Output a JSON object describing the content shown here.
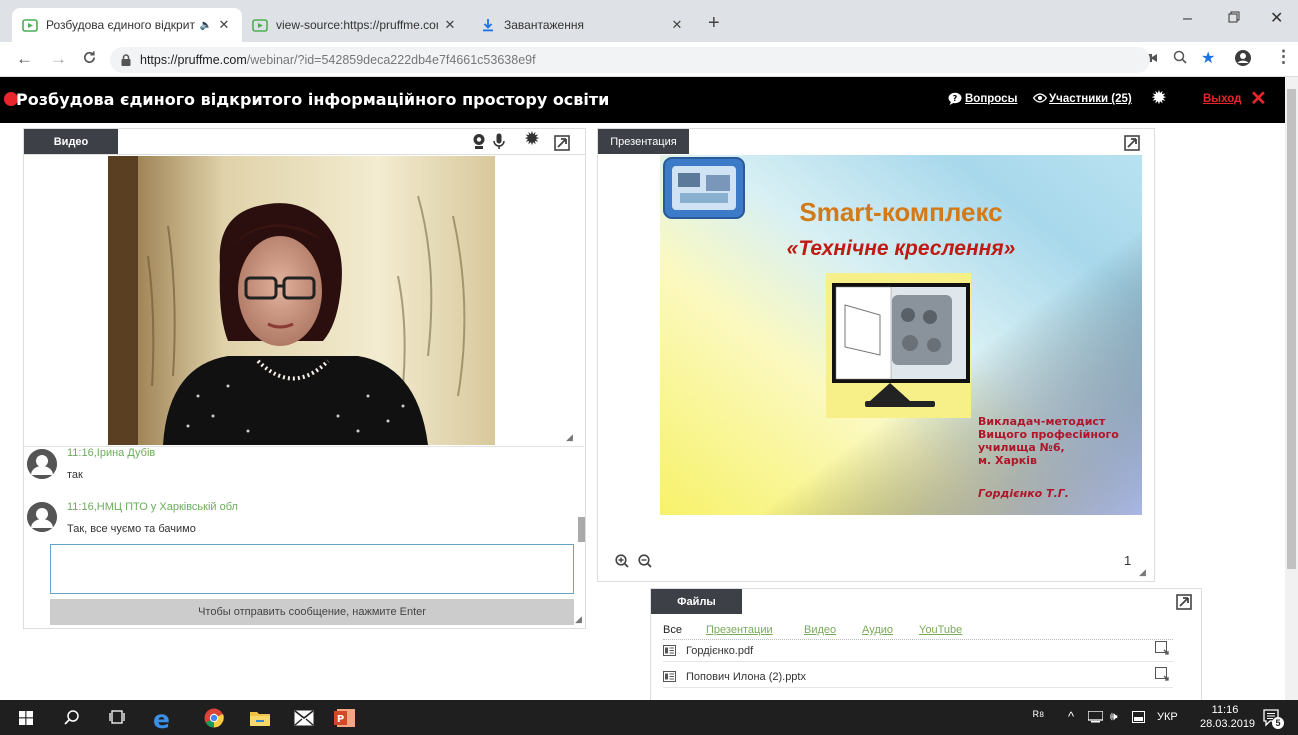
{
  "browser": {
    "tabs": [
      {
        "title": "Розбудова єдиного відкрит",
        "audio": "🔈"
      },
      {
        "title": "view-source:https://pruffme.com"
      },
      {
        "title": "Завантаження"
      }
    ],
    "url_host": "https://pruffme.com",
    "url_path": "/webinar/?id=542859deca222db4e7f4661c53638e9f"
  },
  "webinar": {
    "title": "Розбудова єдиного відкритого інформаційного простору освіти",
    "questions_label": "Вопросы",
    "participants_label": "Участники (25)",
    "exit_label": "Выход"
  },
  "video_panel": {
    "tab_label": "Видео"
  },
  "chat": {
    "messages": [
      {
        "time_name": "11:16,Ірина Дубів",
        "text": "так"
      },
      {
        "time_name": "11:16,НМЦ ПТО у Харківській обл",
        "text": "Так, все чуємо та бачимо"
      }
    ],
    "input_value": "",
    "send_hint": "Чтобы отправить сообщение, нажмите Enter"
  },
  "presentation": {
    "tab_label": "Презентация",
    "slide": {
      "title": "Smart-комплекс",
      "subtitle": "«Технічне креслення»",
      "author_line1": "Викладач-методист",
      "author_line2": "Вищого професійного",
      "author_line3": "училища №6,",
      "author_line4": "м. Харків",
      "author_name": "Гордієнко Т.Г."
    },
    "page_number": "1"
  },
  "files": {
    "tab_label": "Файлы",
    "filters": [
      "Все",
      "Презентации",
      "Видео",
      "Аудио",
      "YouTube"
    ],
    "items": [
      {
        "name": "Гордієнко.pdf"
      },
      {
        "name": "Попович Илона (2).pptx"
      }
    ]
  },
  "taskbar": {
    "lang": "УКР",
    "time": "11:16",
    "date": "28.03.2019",
    "notifications": "5"
  },
  "colors": {
    "header_bg": "#000000",
    "exit_red": "#e8262b",
    "link_green": "#7aa95a",
    "slide_title_orange": "#d27a18",
    "slide_subtitle_red": "#c01a12",
    "slide_author_red": "#b0152a"
  }
}
